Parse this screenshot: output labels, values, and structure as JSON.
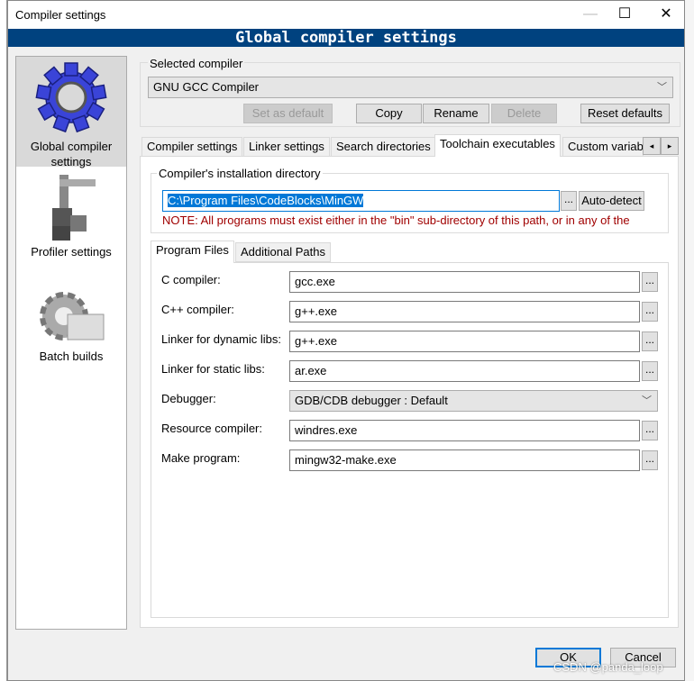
{
  "window": {
    "title": "Compiler settings",
    "banner": "Global compiler settings",
    "controls": {
      "minimize": "—",
      "maximize": "☐",
      "close": "✕"
    }
  },
  "sidebar": {
    "items": [
      {
        "label": "Global compiler settings",
        "icon": "gear-icon"
      },
      {
        "label": "Profiler settings",
        "icon": "caliper-icon"
      },
      {
        "label": "Batch builds",
        "icon": "batch-gear-icon"
      }
    ]
  },
  "compiler": {
    "group_label": "Selected compiler",
    "selected": "GNU GCC Compiler",
    "buttons": {
      "set_default": "Set as default",
      "copy": "Copy",
      "rename": "Rename",
      "delete": "Delete",
      "reset": "Reset defaults"
    }
  },
  "tabs": [
    {
      "label": "Compiler settings"
    },
    {
      "label": "Linker settings"
    },
    {
      "label": "Search directories"
    },
    {
      "label": "Toolchain executables"
    },
    {
      "label": "Custom variab"
    }
  ],
  "install": {
    "group_label": "Compiler's installation directory",
    "value": "C:\\Program Files\\CodeBlocks\\MinGW",
    "browse": "...",
    "autodetect": "Auto-detect",
    "note": "NOTE: All programs must exist either in the \"bin\" sub-directory of this path, or in any of the"
  },
  "subtabs": [
    {
      "label": "Program Files"
    },
    {
      "label": "Additional Paths"
    }
  ],
  "programs": [
    {
      "label": "C compiler:",
      "value": "gcc.exe"
    },
    {
      "label": "C++ compiler:",
      "value": "g++.exe"
    },
    {
      "label": "Linker for dynamic libs:",
      "value": "g++.exe"
    },
    {
      "label": "Linker for static libs:",
      "value": "ar.exe"
    },
    {
      "label": "Debugger:",
      "value": "GDB/CDB debugger : Default",
      "type": "select"
    },
    {
      "label": "Resource compiler:",
      "value": "windres.exe"
    },
    {
      "label": "Make program:",
      "value": "mingw32-make.exe"
    }
  ],
  "footer": {
    "ok": "OK",
    "cancel": "Cancel"
  },
  "watermark": "CSDN @panda_loop",
  "colors": {
    "banner": "#00427f",
    "note": "#a00000",
    "selection": "#0078d7"
  }
}
